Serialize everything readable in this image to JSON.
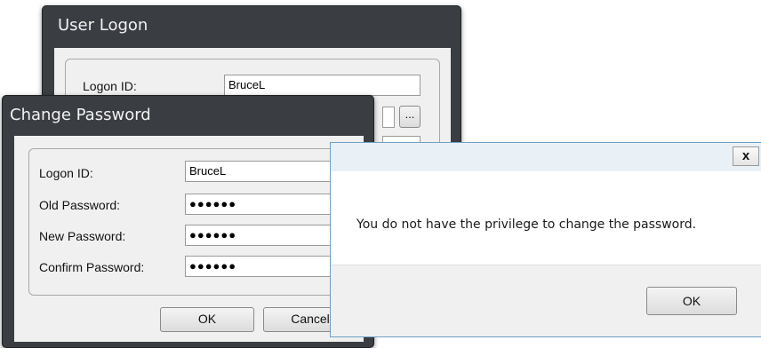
{
  "logon_dialog": {
    "title": "User Logon",
    "logon_id_label": "Logon ID:",
    "logon_id_value": "BruceL",
    "browse_label": "..."
  },
  "change_password_dialog": {
    "title": "Change Password",
    "fields": [
      {
        "label": "Logon ID:",
        "value": "BruceL"
      },
      {
        "label": "Old Password:",
        "value": "●●●●●●"
      },
      {
        "label": "New Password:",
        "value": "●●●●●●"
      },
      {
        "label": "Confirm Password:",
        "value": "●●●●●●"
      }
    ],
    "ok_label": "OK",
    "cancel_label": "Cancel"
  },
  "message_box": {
    "close_label": "x",
    "message": "You do not have the privilege to change the password.",
    "ok_label": "OK"
  },
  "colors": {
    "dialog_frame": "#3a3d42",
    "client_background": "#f0f0f0",
    "message_box_border": "#6f9fc2"
  }
}
